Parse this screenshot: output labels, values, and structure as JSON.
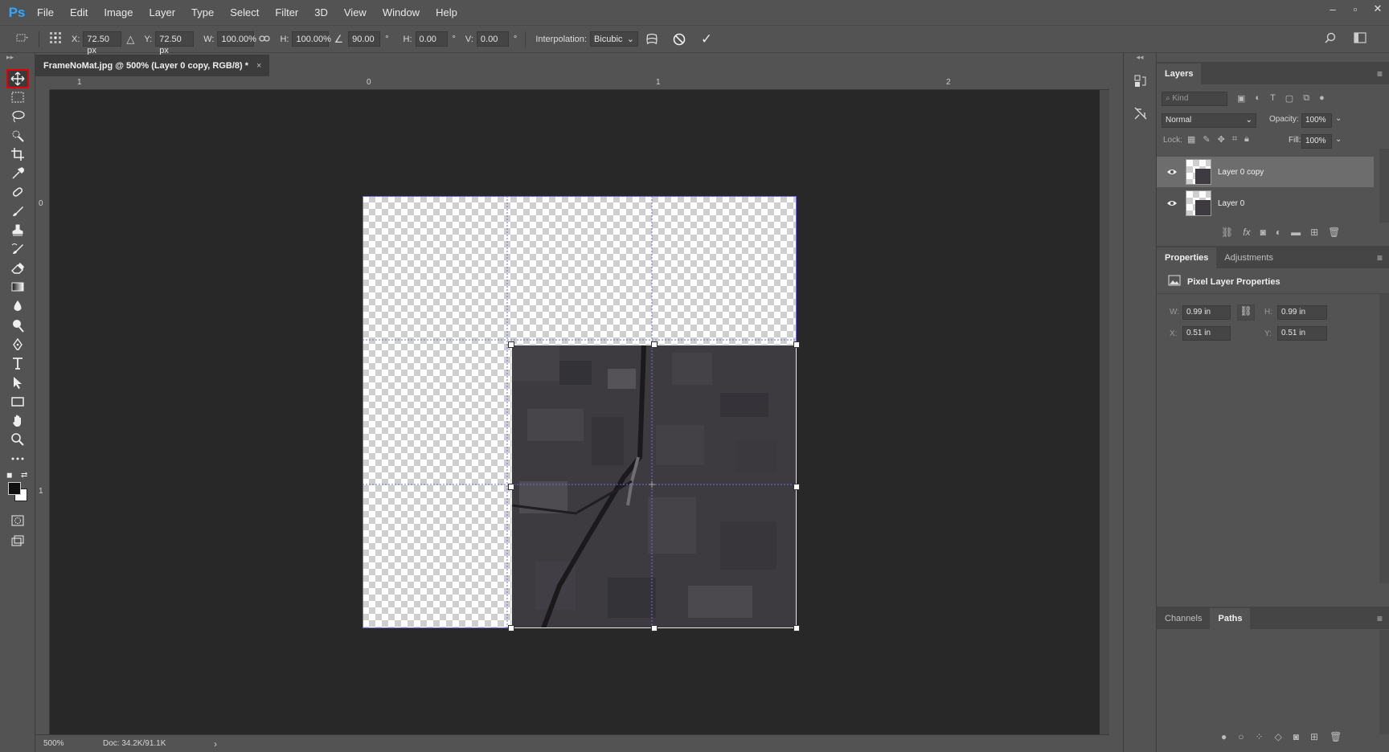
{
  "app": {
    "logo": "Ps",
    "menu": [
      "File",
      "Edit",
      "Image",
      "Layer",
      "Type",
      "Select",
      "Filter",
      "3D",
      "View",
      "Window",
      "Help"
    ],
    "window_controls": [
      "–",
      "▫",
      "✕"
    ]
  },
  "options_bar": {
    "x_label": "X:",
    "x_value": "72.50 px",
    "y_label": "Y:",
    "y_value": "72.50 px",
    "w_label": "W:",
    "w_value": "100.00%",
    "h_label": "H:",
    "h_value": "100.00%",
    "angle_value": "90.00",
    "degree": "°",
    "hskew_label": "H:",
    "hskew_value": "0.00",
    "vskew_label": "V:",
    "vskew_value": "0.00",
    "interpolation_label": "Interpolation:",
    "interpolation_value": "Bicubic",
    "cancel_symbol": "⃠",
    "commit_symbol": "✓"
  },
  "document": {
    "tab_title": "FrameNoMat.jpg @ 500% (Layer 0 copy, RGB/8) *",
    "tab_close": "×",
    "ruler_top_labels": [
      "1",
      "0",
      "1",
      "2"
    ],
    "ruler_left_labels": [
      "0",
      "1"
    ],
    "zoom": "500%",
    "doc_size": "Doc: 34.2K/91.1K",
    "status_arrow": "›"
  },
  "layers_panel": {
    "tab": "Layers",
    "kind_placeholder": "Kind",
    "blend_mode": "Normal",
    "opacity_label": "Opacity:",
    "opacity_value": "100%",
    "lock_label": "Lock:",
    "fill_label": "Fill:",
    "fill_value": "100%",
    "layers": [
      {
        "name": "Layer 0 copy",
        "selected": true,
        "visible": true
      },
      {
        "name": "Layer 0",
        "selected": false,
        "visible": true
      }
    ]
  },
  "properties_panel": {
    "tabs": [
      "Properties",
      "Adjustments"
    ],
    "title": "Pixel Layer Properties",
    "w_label": "W:",
    "w_value": "0.99 in",
    "h_label": "H:",
    "h_value": "0.99 in",
    "x_label": "X:",
    "x_value": "0.51 in",
    "y_label": "Y:",
    "y_value": "0.51 in"
  },
  "paths_panel": {
    "tabs": [
      "Channels",
      "Paths"
    ],
    "active_tab": "Paths"
  },
  "colors": {
    "accent_red": "#e60000",
    "ps_blue": "#31a8ff",
    "guide": "#6d6dd6"
  }
}
